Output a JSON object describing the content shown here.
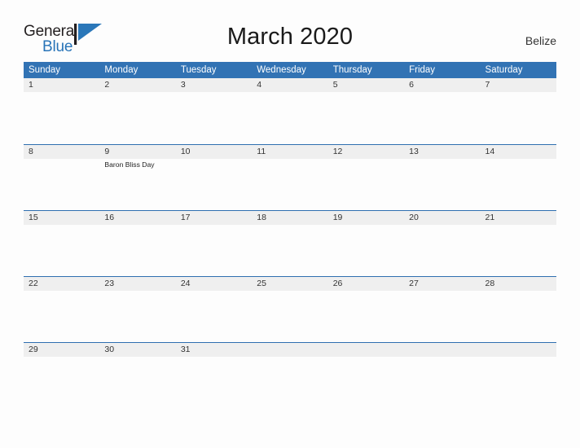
{
  "brand": {
    "name_part1": "General",
    "name_part2": "Blue",
    "flag_icon": "blue-flag-triangle",
    "color_dark": "#231f20",
    "color_blue": "#2874b8"
  },
  "header": {
    "title": "March 2020",
    "country": "Belize"
  },
  "theme": {
    "header_blue": "#3273b4",
    "row_line_blue": "#2f6fb0",
    "date_band_gray": "#efefef",
    "page_background": "#fdfdfd"
  },
  "calendar": {
    "month": "March",
    "year": "2020",
    "weekday_headers": [
      "Sunday",
      "Monday",
      "Tuesday",
      "Wednesday",
      "Thursday",
      "Friday",
      "Saturday"
    ],
    "weeks": [
      {
        "days": [
          {
            "date": "1",
            "event": ""
          },
          {
            "date": "2",
            "event": ""
          },
          {
            "date": "3",
            "event": ""
          },
          {
            "date": "4",
            "event": ""
          },
          {
            "date": "5",
            "event": ""
          },
          {
            "date": "6",
            "event": ""
          },
          {
            "date": "7",
            "event": ""
          }
        ]
      },
      {
        "days": [
          {
            "date": "8",
            "event": ""
          },
          {
            "date": "9",
            "event": "Baron Bliss Day"
          },
          {
            "date": "10",
            "event": ""
          },
          {
            "date": "11",
            "event": ""
          },
          {
            "date": "12",
            "event": ""
          },
          {
            "date": "13",
            "event": ""
          },
          {
            "date": "14",
            "event": ""
          }
        ]
      },
      {
        "days": [
          {
            "date": "15",
            "event": ""
          },
          {
            "date": "16",
            "event": ""
          },
          {
            "date": "17",
            "event": ""
          },
          {
            "date": "18",
            "event": ""
          },
          {
            "date": "19",
            "event": ""
          },
          {
            "date": "20",
            "event": ""
          },
          {
            "date": "21",
            "event": ""
          }
        ]
      },
      {
        "days": [
          {
            "date": "22",
            "event": ""
          },
          {
            "date": "23",
            "event": ""
          },
          {
            "date": "24",
            "event": ""
          },
          {
            "date": "25",
            "event": ""
          },
          {
            "date": "26",
            "event": ""
          },
          {
            "date": "27",
            "event": ""
          },
          {
            "date": "28",
            "event": ""
          }
        ]
      },
      {
        "days": [
          {
            "date": "29",
            "event": ""
          },
          {
            "date": "30",
            "event": ""
          },
          {
            "date": "31",
            "event": ""
          },
          {
            "date": "",
            "event": ""
          },
          {
            "date": "",
            "event": ""
          },
          {
            "date": "",
            "event": ""
          },
          {
            "date": "",
            "event": ""
          }
        ]
      }
    ]
  }
}
